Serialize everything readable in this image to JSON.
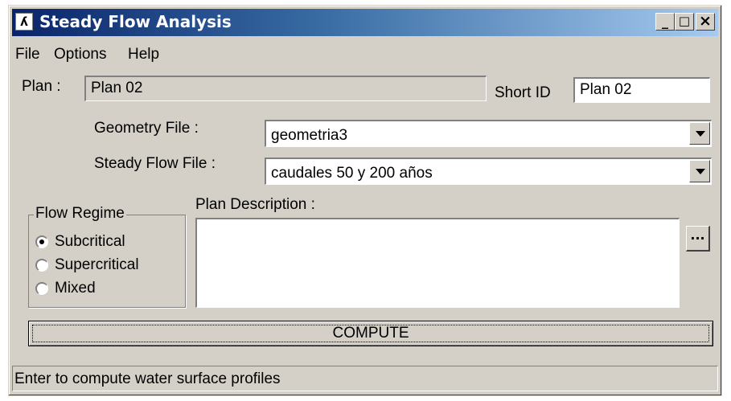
{
  "window": {
    "title": "Steady Flow Analysis",
    "controls": {
      "minimize": "_",
      "maximize": "□",
      "close": "×"
    }
  },
  "menu": [
    "File",
    "Options",
    "Help"
  ],
  "plan": {
    "label": "Plan :",
    "value": "Plan 02"
  },
  "short_id": {
    "label": "Short ID",
    "value": "Plan 02"
  },
  "geometry": {
    "label": "Geometry File :",
    "value": "geometria3"
  },
  "steady_flow": {
    "label": "Steady Flow File :",
    "value": "caudales 50 y 200 años"
  },
  "flow_regime": {
    "title": "Flow Regime",
    "options": [
      "Subcritical",
      "Supercritical",
      "Mixed"
    ],
    "selected": "Subcritical"
  },
  "plan_description": {
    "label": "Plan Description :",
    "value": "",
    "button": "..."
  },
  "compute": {
    "label": "COMPUTE"
  },
  "status": {
    "text": "Enter to compute water surface profiles"
  },
  "colors": {
    "face": "#d4d0c8",
    "title_start": "#0a246a",
    "title_end": "#a6caf0"
  },
  "icons": {
    "app": "hec-ras-app-icon",
    "dropdown": "chevron-down-icon"
  }
}
